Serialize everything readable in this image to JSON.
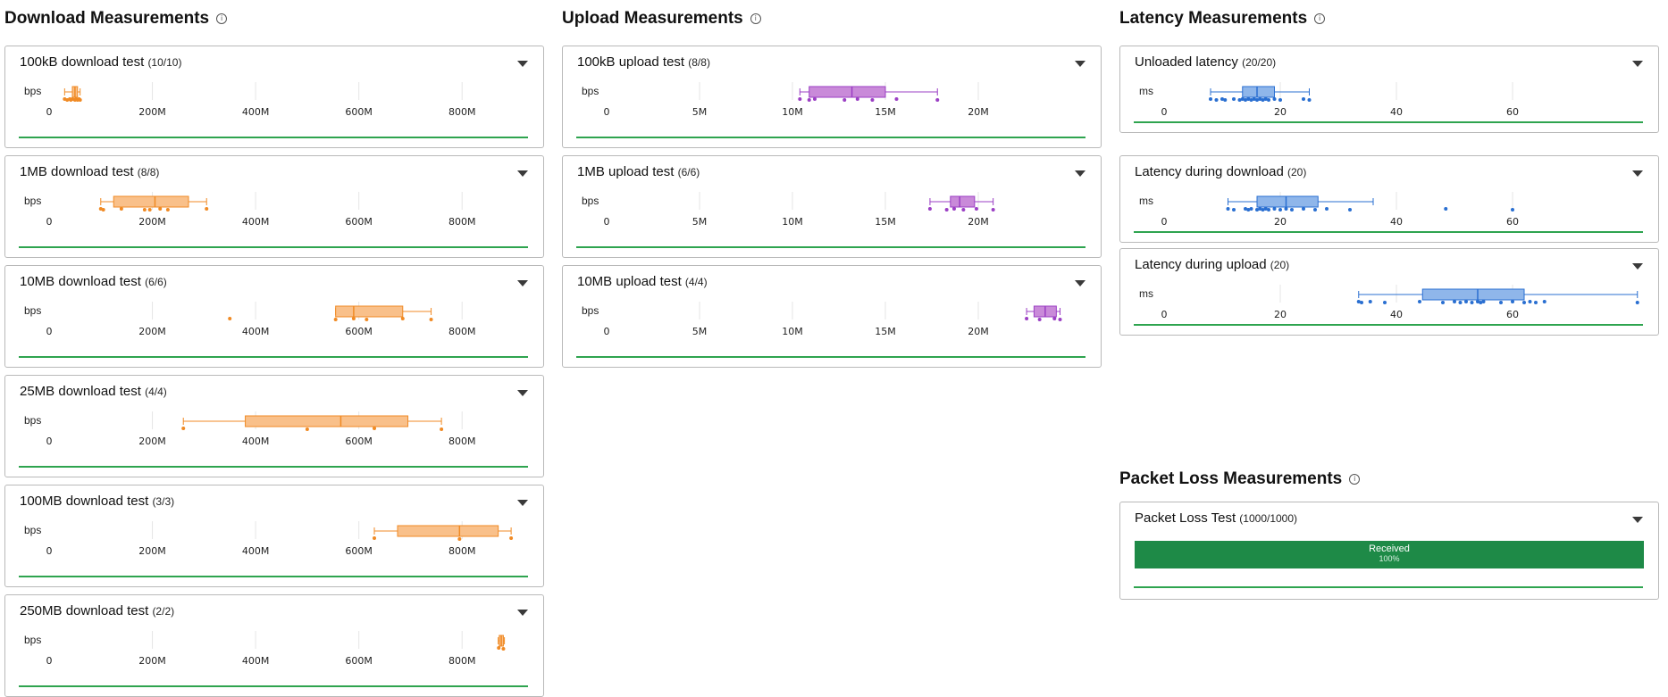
{
  "colors": {
    "download": "#f08a24",
    "download_fill": "#f9c08a",
    "upload": "#9b3fc4",
    "upload_fill": "#c98ad9",
    "latency": "#2a6fd1",
    "latency_fill": "#8fb6ea",
    "received": "#1e8a47",
    "progress": "#2ea44f"
  },
  "icons": {
    "info": "info-circle-icon",
    "chevron": "chevron-down-icon"
  },
  "info_glyph": "i",
  "download": {
    "title": "Download Measurements",
    "unit": "bps",
    "axis": {
      "min": 0,
      "max": 900000000,
      "ticks": [
        0,
        200000000,
        400000000,
        600000000,
        800000000
      ],
      "tick_labels": [
        "0",
        "200M",
        "400M",
        "600M",
        "800M"
      ]
    },
    "tests": [
      {
        "name": "100kB download test",
        "count": "(10/10)",
        "stats": {
          "min": 30000000,
          "q1": 45000000,
          "median": 50000000,
          "q3": 55000000,
          "max": 60000000
        },
        "points": [
          30000000,
          35000000,
          40000000,
          42000000,
          45000000,
          50000000,
          52000000,
          55000000,
          58000000,
          60000000
        ]
      },
      {
        "name": "1MB download test",
        "count": "(8/8)",
        "stats": {
          "min": 100000000,
          "q1": 125000000,
          "median": 205000000,
          "q3": 270000000,
          "max": 305000000
        },
        "points": [
          100000000,
          105000000,
          140000000,
          195000000,
          215000000,
          230000000,
          305000000,
          185000000
        ]
      },
      {
        "name": "10MB download test",
        "count": "(6/6)",
        "stats": {
          "min": 555000000,
          "q1": 555000000,
          "median": 590000000,
          "q3": 685000000,
          "max": 740000000
        },
        "points": [
          350000000,
          555000000,
          590000000,
          615000000,
          685000000,
          740000000
        ]
      },
      {
        "name": "25MB download test",
        "count": "(4/4)",
        "stats": {
          "min": 260000000,
          "q1": 380000000,
          "median": 565000000,
          "q3": 695000000,
          "max": 760000000
        },
        "points": [
          260000000,
          500000000,
          630000000,
          760000000
        ]
      },
      {
        "name": "100MB download test",
        "count": "(3/3)",
        "stats": {
          "min": 630000000,
          "q1": 675000000,
          "median": 795000000,
          "q3": 870000000,
          "max": 895000000
        },
        "points": [
          630000000,
          795000000,
          895000000
        ]
      },
      {
        "name": "250MB download test",
        "count": "(2/2)",
        "stats": {
          "min": 870000000,
          "q1": 872000000,
          "median": 876000000,
          "q3": 880000000,
          "max": 882000000
        },
        "points": [
          871000000,
          880000000
        ]
      }
    ]
  },
  "upload": {
    "title": "Upload Measurements",
    "unit": "bps",
    "axis": {
      "min": 0,
      "max": 25000000,
      "ticks": [
        0,
        5000000,
        10000000,
        15000000,
        20000000
      ],
      "tick_labels": [
        "0",
        "5M",
        "10M",
        "15M",
        "20M"
      ]
    },
    "tests": [
      {
        "name": "100kB upload test",
        "count": "(8/8)",
        "stats": {
          "min": 10400000,
          "q1": 10900000,
          "median": 13200000,
          "q3": 15000000,
          "max": 17800000
        },
        "points": [
          10400000,
          10900000,
          11200000,
          12800000,
          13500000,
          14300000,
          15600000,
          17800000
        ]
      },
      {
        "name": "1MB upload test",
        "count": "(6/6)",
        "stats": {
          "min": 17400000,
          "q1": 18500000,
          "median": 19000000,
          "q3": 19800000,
          "max": 20800000
        },
        "points": [
          17400000,
          18300000,
          18700000,
          19200000,
          19900000,
          20800000
        ]
      },
      {
        "name": "10MB upload test",
        "count": "(4/4)",
        "stats": {
          "min": 22600000,
          "q1": 23000000,
          "median": 23600000,
          "q3": 24200000,
          "max": 24400000
        },
        "points": [
          22600000,
          23300000,
          24100000,
          24400000
        ]
      }
    ]
  },
  "latency": {
    "title": "Latency Measurements",
    "unit": "ms",
    "axis": {
      "min": 0,
      "max": 80,
      "ticks": [
        0,
        20,
        40,
        60
      ],
      "tick_labels": [
        "0",
        "20",
        "40",
        "60"
      ]
    },
    "tests": [
      {
        "name": "Unloaded latency",
        "count": "(20/20)",
        "stats": {
          "min": 8,
          "q1": 13.5,
          "median": 16,
          "q3": 19,
          "max": 25
        },
        "points": [
          8,
          9,
          10,
          10.5,
          12,
          13,
          13.5,
          14,
          14.5,
          15,
          15.5,
          16,
          16.5,
          17,
          17.5,
          18,
          19,
          20,
          24,
          25
        ]
      },
      {
        "name": "Latency during download",
        "count": "(20)",
        "stats": {
          "min": 11,
          "q1": 16,
          "median": 21,
          "q3": 26.5,
          "max": 36
        },
        "points": [
          11,
          12,
          14,
          14.5,
          15,
          16,
          16.5,
          17,
          17.5,
          18,
          19,
          20,
          21,
          22,
          24,
          26,
          28,
          32,
          48.5,
          60
        ]
      },
      {
        "name": "Latency during upload",
        "count": "(20)",
        "stats": {
          "min": 33.5,
          "q1": 44.5,
          "median": 54,
          "q3": 62,
          "max": 81.5
        },
        "points": [
          33.5,
          34,
          35.5,
          38,
          44,
          48,
          50,
          51,
          52,
          53,
          54,
          54.5,
          55,
          58,
          60,
          62,
          63,
          64,
          65.5,
          81.5
        ]
      }
    ]
  },
  "packet_loss": {
    "title": "Packet Loss Measurements",
    "test": {
      "name": "Packet Loss Test",
      "count": "(1000/1000)",
      "received_label": "Received",
      "received_pct_label": "100%",
      "received_fraction": 1.0
    }
  }
}
